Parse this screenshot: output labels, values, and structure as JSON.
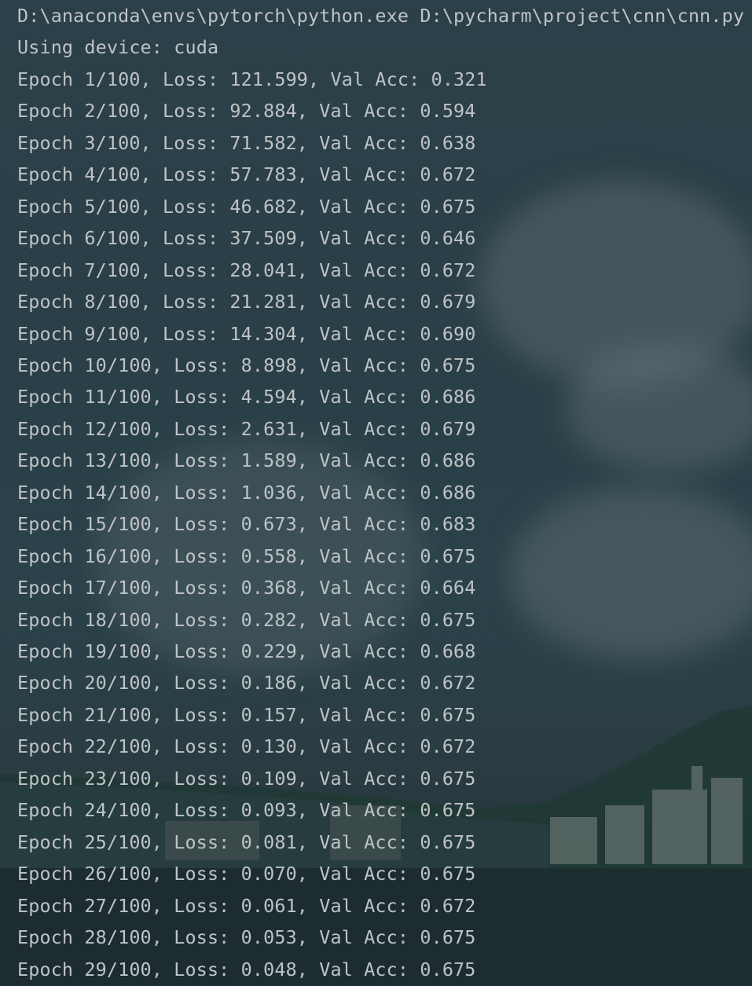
{
  "console": {
    "command": "D:\\anaconda\\envs\\pytorch\\python.exe D:\\pycharm\\project\\cnn\\cnn.py",
    "lines": [
      "Using device: cuda",
      "Epoch 1/100, Loss: 121.599, Val Acc: 0.321",
      "Epoch 2/100, Loss: 92.884, Val Acc: 0.594",
      "Epoch 3/100, Loss: 71.582, Val Acc: 0.638",
      "Epoch 4/100, Loss: 57.783, Val Acc: 0.672",
      "Epoch 5/100, Loss: 46.682, Val Acc: 0.675",
      "Epoch 6/100, Loss: 37.509, Val Acc: 0.646",
      "Epoch 7/100, Loss: 28.041, Val Acc: 0.672",
      "Epoch 8/100, Loss: 21.281, Val Acc: 0.679",
      "Epoch 9/100, Loss: 14.304, Val Acc: 0.690",
      "Epoch 10/100, Loss: 8.898, Val Acc: 0.675",
      "Epoch 11/100, Loss: 4.594, Val Acc: 0.686",
      "Epoch 12/100, Loss: 2.631, Val Acc: 0.679",
      "Epoch 13/100, Loss: 1.589, Val Acc: 0.686",
      "Epoch 14/100, Loss: 1.036, Val Acc: 0.686",
      "Epoch 15/100, Loss: 0.673, Val Acc: 0.683",
      "Epoch 16/100, Loss: 0.558, Val Acc: 0.675",
      "Epoch 17/100, Loss: 0.368, Val Acc: 0.664",
      "Epoch 18/100, Loss: 0.282, Val Acc: 0.675",
      "Epoch 19/100, Loss: 0.229, Val Acc: 0.668",
      "Epoch 20/100, Loss: 0.186, Val Acc: 0.672",
      "Epoch 21/100, Loss: 0.157, Val Acc: 0.675",
      "Epoch 22/100, Loss: 0.130, Val Acc: 0.672",
      "Epoch 23/100, Loss: 0.109, Val Acc: 0.675",
      "Epoch 24/100, Loss: 0.093, Val Acc: 0.675",
      "Epoch 25/100, Loss: 0.081, Val Acc: 0.675",
      "Epoch 26/100, Loss: 0.070, Val Acc: 0.675",
      "Epoch 27/100, Loss: 0.061, Val Acc: 0.672",
      "Epoch 28/100, Loss: 0.053, Val Acc: 0.675",
      "Epoch 29/100, Loss: 0.048, Val Acc: 0.675"
    ]
  },
  "colors": {
    "text": "#bfc3c6",
    "background": "#22343b"
  }
}
